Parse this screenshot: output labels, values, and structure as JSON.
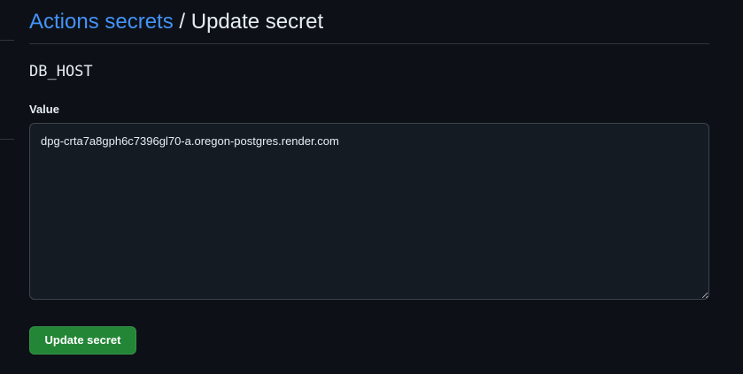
{
  "breadcrumb": {
    "parent_label": "Actions secrets",
    "separator": " / ",
    "current_label": "Update secret"
  },
  "secret": {
    "name": "DB_HOST"
  },
  "value_field": {
    "label": "Value",
    "value": "dpg-crta7a8gph6c7396gl70-a.oregon-postgres.render.com"
  },
  "actions": {
    "submit_label": "Update secret"
  },
  "colors": {
    "background": "#0d1117",
    "link": "#4493f8",
    "primary_button": "#238636",
    "input_background": "#151b23",
    "border": "#30363d"
  }
}
